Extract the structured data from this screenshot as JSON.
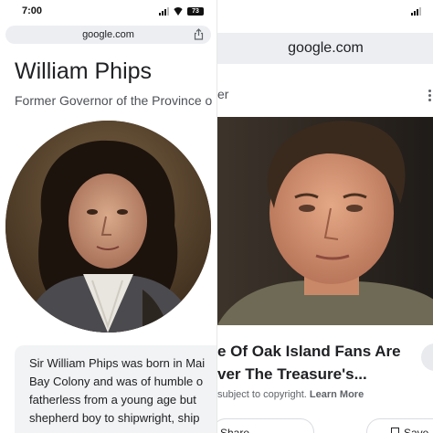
{
  "left_screen": {
    "status": {
      "time": "7:00",
      "battery": "73"
    },
    "url": "google.com",
    "title": "William Phips",
    "subtitle": "Former Governor of the Province o",
    "description_lines": [
      "Sir William Phips was born in Mai",
      "Bay Colony and was of humble o",
      "fatherless from a young age but",
      "shepherd boy to shipwright, ship"
    ]
  },
  "right_screen": {
    "url": "google.com",
    "subtitle_fragment": "er",
    "headline_lines": [
      "e Of Oak Island Fans Are",
      "ver The Treasure's..."
    ],
    "copyright_text": "subject to copyright.",
    "copyright_link": "Learn More",
    "share_label": "Share",
    "save_label": "Save"
  },
  "colors": {
    "url_bar_bg": "#eceef1",
    "card_bg": "#f1f3f4",
    "text_primary": "#202124",
    "text_secondary": "#4d5156"
  }
}
